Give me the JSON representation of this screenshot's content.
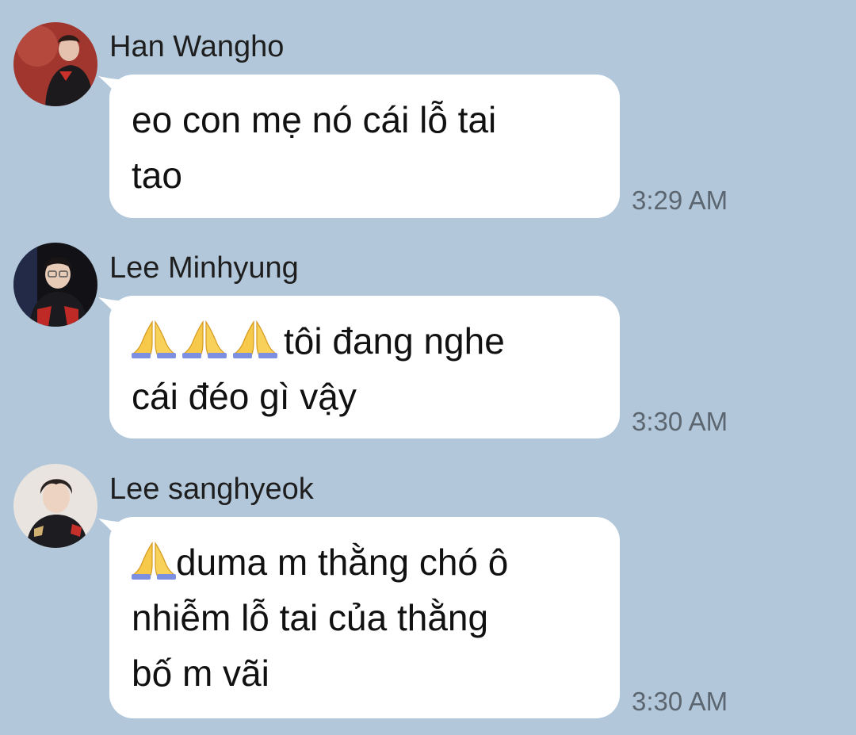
{
  "colors": {
    "background": "#b2c7da",
    "bubble": "#ffffff",
    "sender_text": "#1e1e1e",
    "time_text": "#5b6670"
  },
  "messages": [
    {
      "sender": "Han Wangho",
      "avatar_icon": "avatar-photo-han-wangho",
      "text_lines": [
        "eo con mẹ nó cái lỗ tai",
        "tao"
      ],
      "time": "3:29 AM"
    },
    {
      "sender": "Lee Minhyung",
      "avatar_icon": "avatar-photo-lee-minhyung",
      "emoji": "folded-hands-icon",
      "text_lines": [
        "tôi đang nghe",
        "cái đéo gì vậy"
      ],
      "time": "3:30 AM"
    },
    {
      "sender": "Lee sanghyeok",
      "avatar_icon": "avatar-photo-lee-sanghyeok",
      "emoji": "folded-hands-icon",
      "text_lines": [
        "duma m thằng chó ô",
        "nhiễm lỗ tai của thằng",
        "bố m vãi"
      ],
      "time": "3:30 AM"
    }
  ]
}
